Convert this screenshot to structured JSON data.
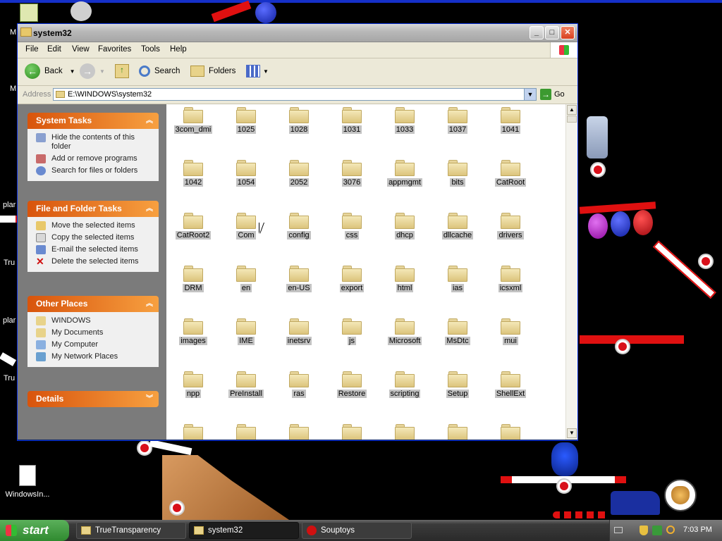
{
  "desktop": {
    "icons": [
      {
        "label": "WindowsIn..."
      }
    ],
    "fragments": [
      {
        "text": "M"
      },
      {
        "text": "M"
      },
      {
        "text": "plar"
      },
      {
        "text": "Tru"
      },
      {
        "text": "plar"
      },
      {
        "text": "Tru"
      }
    ]
  },
  "window": {
    "title": "system32",
    "controls": {
      "minimize": "_",
      "maximize": "□",
      "close": "✕"
    },
    "menu": [
      "File",
      "Edit",
      "View",
      "Favorites",
      "Tools",
      "Help"
    ],
    "toolbar": {
      "back": "Back",
      "search": "Search",
      "folders": "Folders"
    },
    "address": {
      "label": "Address",
      "value": "E:\\WINDOWS\\system32",
      "go": "Go"
    },
    "left_panel": {
      "system_tasks": {
        "title": "System Tasks",
        "items": [
          "Hide the contents of this folder",
          "Add or remove programs",
          "Search for files or folders"
        ]
      },
      "file_folder_tasks": {
        "title": "File and Folder Tasks",
        "items": [
          "Move the selected items",
          "Copy the selected items",
          "E-mail the selected items",
          "Delete the selected items"
        ]
      },
      "other_places": {
        "title": "Other Places",
        "items": [
          "WINDOWS",
          "My Documents",
          "My Computer",
          "My Network Places"
        ]
      },
      "details": {
        "title": "Details"
      }
    },
    "folders": [
      "3com_dmi",
      "1025",
      "1028",
      "1031",
      "1033",
      "1037",
      "1041",
      "1042",
      "1054",
      "2052",
      "3076",
      "appmgmt",
      "bits",
      "CatRoot",
      "CatRoot2",
      "Com",
      "config",
      "css",
      "dhcp",
      "dllcache",
      "drivers",
      "DRM",
      "en",
      "en-US",
      "export",
      "html",
      "ias",
      "icsxml",
      "images",
      "IME",
      "inetsrv",
      "js",
      "Microsoft",
      "MsDtc",
      "mui",
      "npp",
      "PreInstall",
      "ras",
      "Restore",
      "scripting",
      "Setup",
      "ShellExt"
    ]
  },
  "taskbar": {
    "start": "start",
    "buttons": [
      {
        "label": "TrueTransparency"
      },
      {
        "label": "system32"
      },
      {
        "label": "Souptoys"
      }
    ],
    "time": "7:03 PM"
  },
  "colors": {
    "task_header": "#d8540c",
    "desktop": "#000000",
    "taskbar_active": "#1c1c1c",
    "folder_label_bg": "#c3c3c3"
  }
}
